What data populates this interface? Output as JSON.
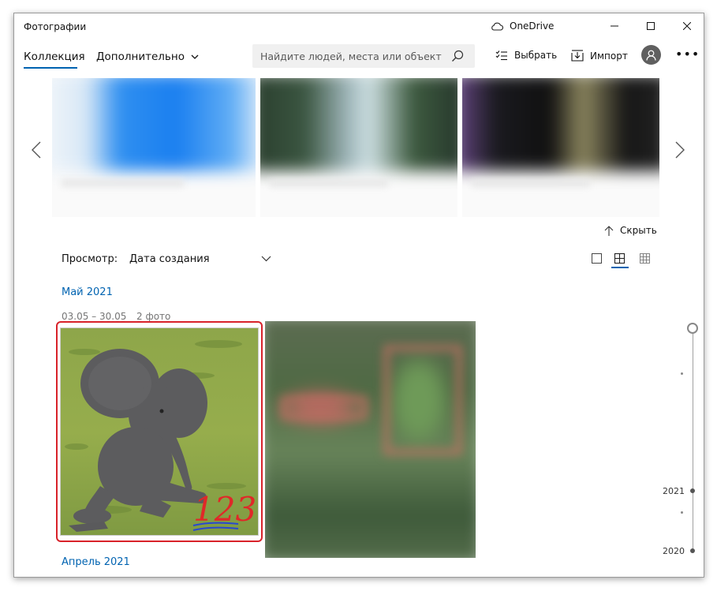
{
  "window": {
    "app_title": "Фотографии",
    "onedrive_label": "OneDrive"
  },
  "commandbar": {
    "tab_collection": "Коллекция",
    "tab_more": "Дополнительно",
    "search_placeholder": "Найдите людей, места или объекты",
    "select_label": "Выбрать",
    "import_label": "Импорт"
  },
  "carousel": {
    "collapse_label": "Скрыть"
  },
  "filter": {
    "view_label": "Просмотр:",
    "sort_value": "Дата создания"
  },
  "sections": [
    {
      "month": "Май 2021",
      "date_range": "03.05 – 30.05",
      "count": "2 фото",
      "overlay_text": "123"
    },
    {
      "month": "Апрель 2021"
    }
  ],
  "timeline": {
    "years": [
      "2021",
      "2020"
    ]
  },
  "colors": {
    "accent": "#0063b1",
    "highlight_frame": "#d8222a"
  }
}
